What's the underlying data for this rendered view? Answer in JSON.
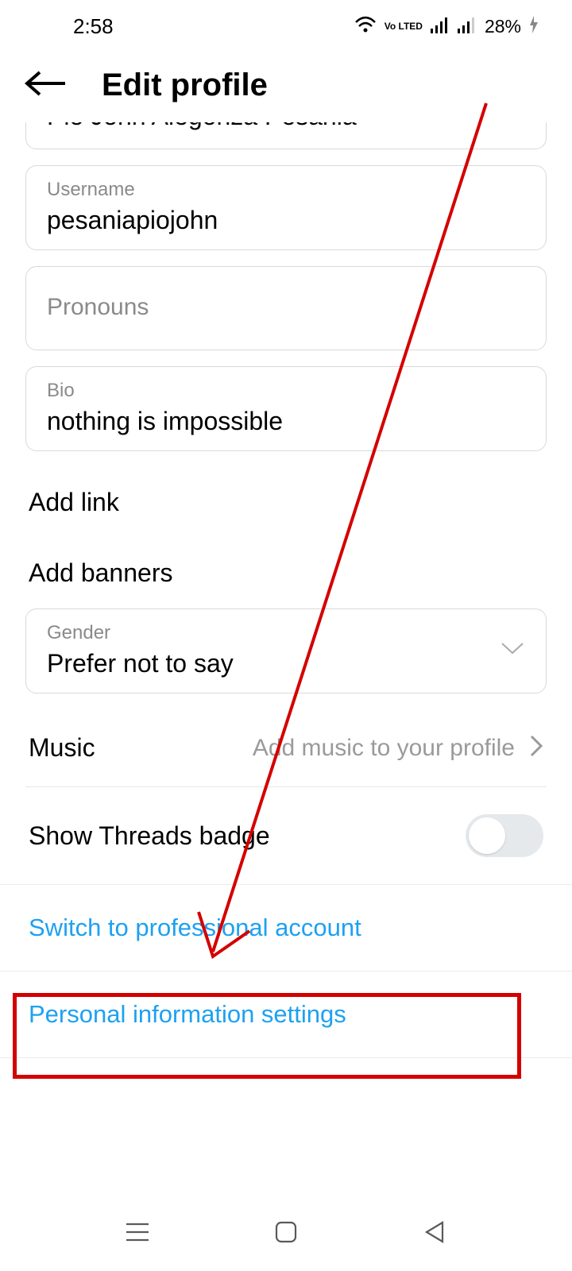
{
  "status": {
    "time": "2:58",
    "volte": "Vo LTED",
    "battery": "28%"
  },
  "header": {
    "title": "Edit profile"
  },
  "name_cut": "Pio John Alegonza Pesania",
  "username": {
    "label": "Username",
    "value": "pesaniapiojohn"
  },
  "pronouns": {
    "placeholder": "Pronouns"
  },
  "bio": {
    "label": "Bio",
    "value": "nothing is impossible"
  },
  "add_link": "Add link",
  "add_banners": "Add banners",
  "gender": {
    "label": "Gender",
    "value": "Prefer not to say"
  },
  "music": {
    "label": "Music",
    "hint": "Add music to your profile"
  },
  "threads": {
    "label": "Show Threads badge",
    "on": false
  },
  "switch_pro": "Switch to professional account",
  "personal_info": "Personal information settings"
}
